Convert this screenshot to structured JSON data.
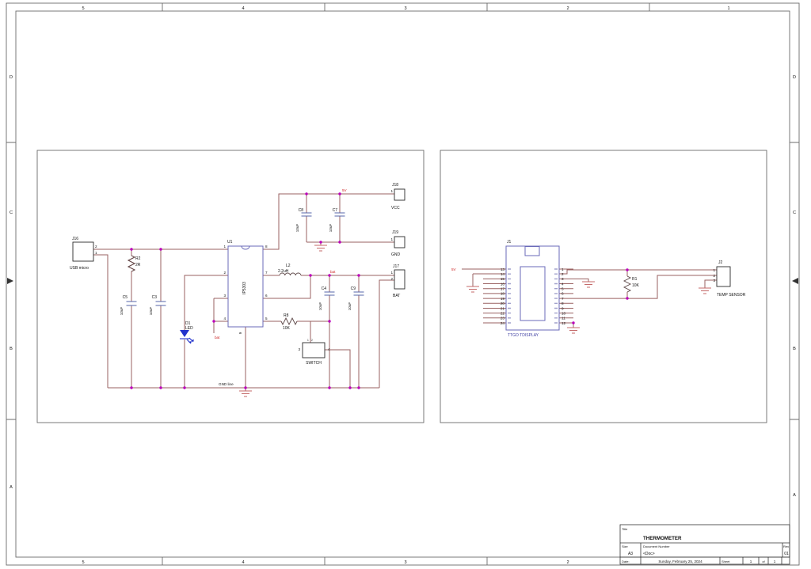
{
  "sheet": {
    "zone_cols": [
      "5",
      "4",
      "3",
      "2",
      "1"
    ],
    "zone_rows": [
      "D",
      "C",
      "B",
      "A"
    ]
  },
  "title_block": {
    "title_label": "Title",
    "title": "THERMOMETER",
    "size_label": "Size",
    "size": "A3",
    "doc_label": "Document Number",
    "doc": "<Doc>",
    "rev_label": "Rev",
    "rev": "01",
    "date_label": "Date:",
    "date": "Sunday, February 25, 2024",
    "sheet_label": "Sheet",
    "sheet_number": "1",
    "of_label": "of",
    "sheet_total": "1"
  },
  "power_block": {
    "j16": {
      "ref": "J16",
      "name": "USB micro",
      "pin2": "2",
      "pin1": "1"
    },
    "r2": {
      "ref": "R2",
      "value": "2R"
    },
    "c5": {
      "ref": "C5",
      "value": "10uF"
    },
    "c3": {
      "ref": "C3",
      "value": "10uF"
    },
    "d1": {
      "ref": "D1",
      "value": "LED"
    },
    "u1": {
      "ref": "U1",
      "value": "IP5303",
      "pins_left": [
        "1",
        "2",
        "3",
        "4"
      ],
      "pins_right": [
        "8",
        "7",
        "6",
        "5"
      ],
      "pin_bottom": "9"
    },
    "l2": {
      "ref": "L2",
      "value": "2.2uH"
    },
    "c8": {
      "ref": "C8",
      "value": "10uF"
    },
    "c7": {
      "ref": "C7",
      "value": "10uF"
    },
    "c4": {
      "ref": "C4",
      "value": "10uF"
    },
    "c9": {
      "ref": "C9",
      "value": "10uF"
    },
    "r8": {
      "ref": "R8",
      "value": "10K"
    },
    "sw": {
      "label": "SWITCH",
      "pin1": "1",
      "pin2": "2",
      "pin3": "3",
      "pin4": "4"
    },
    "j18": {
      "ref": "J18",
      "name": "VCC",
      "pin": "1"
    },
    "j19": {
      "ref": "J19",
      "name": "GND",
      "pin": "1"
    },
    "j17": {
      "ref": "J17",
      "name": "BAT",
      "pin1": "1",
      "pin2": "2"
    },
    "net_5v": "5V",
    "net_bat": "bat",
    "gnd_line": "GND line"
  },
  "display_block": {
    "j1": {
      "ref": "J1",
      "name": "TTGO TDISPLAY",
      "pins_left": [
        "13",
        "14",
        "15",
        "16",
        "17",
        "18",
        "19",
        "20",
        "21",
        "22",
        "23",
        "24"
      ],
      "pins_right": [
        "1",
        "2",
        "3",
        "4",
        "5",
        "6",
        "7",
        "8",
        "9",
        "10",
        "11",
        "12"
      ]
    },
    "net_5v": "5V",
    "r1": {
      "ref": "R1",
      "value": "10K"
    },
    "j2": {
      "ref": "J2",
      "name": "TEMP SENSOR",
      "pins": [
        "1",
        "2",
        "3"
      ]
    }
  },
  "colors": {
    "wire": "#9a6262",
    "junction": "#bb00bb",
    "net_label": "#cc2222",
    "symbol_blue": "#6a6ab8",
    "ground": "#c46a6a",
    "led": "#2233cc"
  }
}
